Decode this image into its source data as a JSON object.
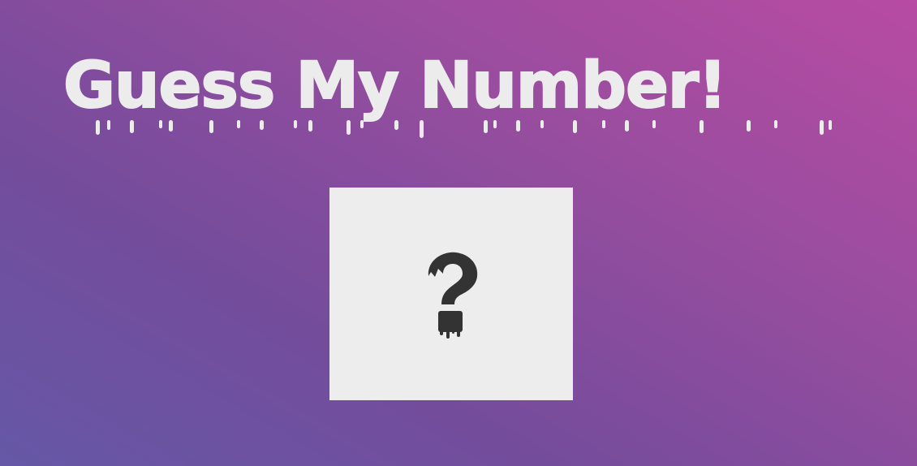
{
  "header": {
    "title": "Guess My Number!"
  },
  "number_box": {
    "hidden_value": "?",
    "icon": "question-mark-icon"
  },
  "colors": {
    "background_start": "#6558a6",
    "background_end": "#b84ba3",
    "title_text": "#ececec",
    "box_background": "#ededed",
    "question_mark": "#333333"
  }
}
